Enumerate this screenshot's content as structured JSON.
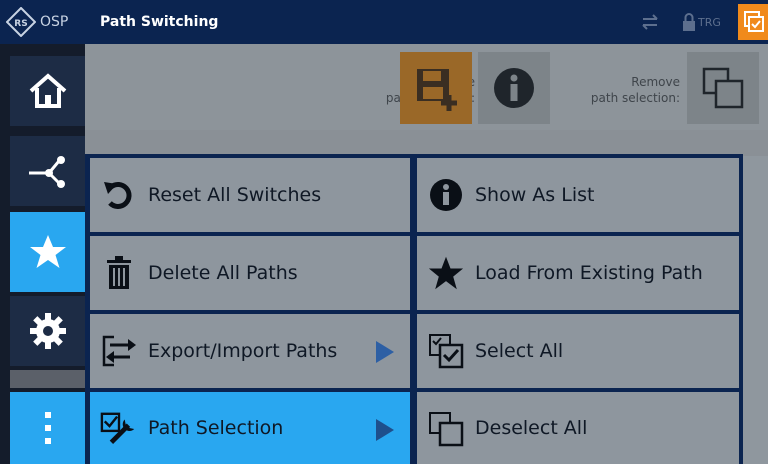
{
  "titlebar": {
    "app_label": "OSP",
    "title": "Path Switching",
    "trigger_label": "TRG",
    "logo_icon": "rohde-schwarz-logo",
    "accent_color": "#f08a1c"
  },
  "leftnav": {
    "items": [
      {
        "name": "home",
        "icon": "home-icon"
      },
      {
        "name": "path",
        "icon": "path-icon"
      },
      {
        "name": "favorites",
        "icon": "star-icon",
        "active": true
      },
      {
        "name": "settings",
        "icon": "gear-icon"
      },
      {
        "name": "more",
        "icon": "more-vertical-icon"
      }
    ]
  },
  "toolbar": {
    "manage_line1": "Manage",
    "manage_line2": "path selection:",
    "remove_line1": "Remove",
    "remove_line2": "path selection:"
  },
  "menu": {
    "reset_all_switches": "Reset All Switches",
    "show_as_list": "Show As List",
    "delete_all_paths": "Delete All Paths",
    "load_from_existing_path": "Load From Existing Path",
    "export_import_paths": "Export/Import Paths",
    "select_all": "Select All",
    "path_selection": "Path Selection",
    "deselect_all": "Deselect All"
  },
  "colors": {
    "navy": "#0b2450",
    "active_blue": "#29a7f0",
    "menu_gray": "#8e969e"
  }
}
